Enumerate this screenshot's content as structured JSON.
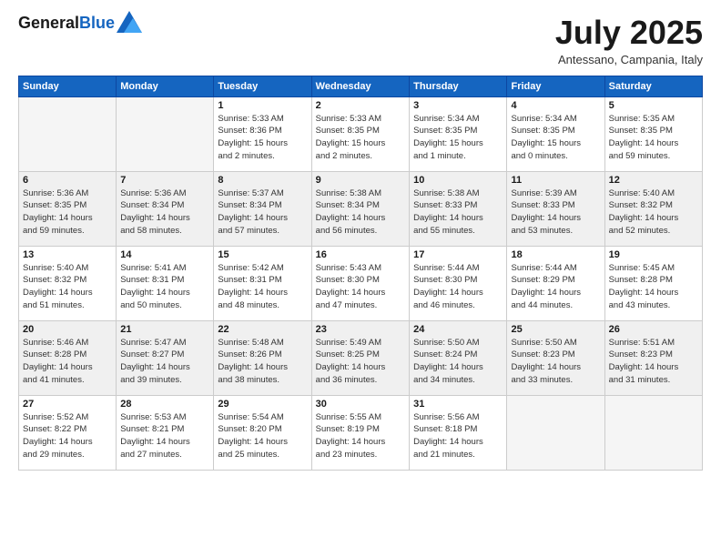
{
  "header": {
    "logo_general": "General",
    "logo_blue": "Blue",
    "month": "July 2025",
    "location": "Antessano, Campania, Italy"
  },
  "days_of_week": [
    "Sunday",
    "Monday",
    "Tuesday",
    "Wednesday",
    "Thursday",
    "Friday",
    "Saturday"
  ],
  "weeks": [
    [
      {
        "day": "",
        "info": ""
      },
      {
        "day": "",
        "info": ""
      },
      {
        "day": "1",
        "info": "Sunrise: 5:33 AM\nSunset: 8:36 PM\nDaylight: 15 hours\nand 2 minutes."
      },
      {
        "day": "2",
        "info": "Sunrise: 5:33 AM\nSunset: 8:35 PM\nDaylight: 15 hours\nand 2 minutes."
      },
      {
        "day": "3",
        "info": "Sunrise: 5:34 AM\nSunset: 8:35 PM\nDaylight: 15 hours\nand 1 minute."
      },
      {
        "day": "4",
        "info": "Sunrise: 5:34 AM\nSunset: 8:35 PM\nDaylight: 15 hours\nand 0 minutes."
      },
      {
        "day": "5",
        "info": "Sunrise: 5:35 AM\nSunset: 8:35 PM\nDaylight: 14 hours\nand 59 minutes."
      }
    ],
    [
      {
        "day": "6",
        "info": "Sunrise: 5:36 AM\nSunset: 8:35 PM\nDaylight: 14 hours\nand 59 minutes."
      },
      {
        "day": "7",
        "info": "Sunrise: 5:36 AM\nSunset: 8:34 PM\nDaylight: 14 hours\nand 58 minutes."
      },
      {
        "day": "8",
        "info": "Sunrise: 5:37 AM\nSunset: 8:34 PM\nDaylight: 14 hours\nand 57 minutes."
      },
      {
        "day": "9",
        "info": "Sunrise: 5:38 AM\nSunset: 8:34 PM\nDaylight: 14 hours\nand 56 minutes."
      },
      {
        "day": "10",
        "info": "Sunrise: 5:38 AM\nSunset: 8:33 PM\nDaylight: 14 hours\nand 55 minutes."
      },
      {
        "day": "11",
        "info": "Sunrise: 5:39 AM\nSunset: 8:33 PM\nDaylight: 14 hours\nand 53 minutes."
      },
      {
        "day": "12",
        "info": "Sunrise: 5:40 AM\nSunset: 8:32 PM\nDaylight: 14 hours\nand 52 minutes."
      }
    ],
    [
      {
        "day": "13",
        "info": "Sunrise: 5:40 AM\nSunset: 8:32 PM\nDaylight: 14 hours\nand 51 minutes."
      },
      {
        "day": "14",
        "info": "Sunrise: 5:41 AM\nSunset: 8:31 PM\nDaylight: 14 hours\nand 50 minutes."
      },
      {
        "day": "15",
        "info": "Sunrise: 5:42 AM\nSunset: 8:31 PM\nDaylight: 14 hours\nand 48 minutes."
      },
      {
        "day": "16",
        "info": "Sunrise: 5:43 AM\nSunset: 8:30 PM\nDaylight: 14 hours\nand 47 minutes."
      },
      {
        "day": "17",
        "info": "Sunrise: 5:44 AM\nSunset: 8:30 PM\nDaylight: 14 hours\nand 46 minutes."
      },
      {
        "day": "18",
        "info": "Sunrise: 5:44 AM\nSunset: 8:29 PM\nDaylight: 14 hours\nand 44 minutes."
      },
      {
        "day": "19",
        "info": "Sunrise: 5:45 AM\nSunset: 8:28 PM\nDaylight: 14 hours\nand 43 minutes."
      }
    ],
    [
      {
        "day": "20",
        "info": "Sunrise: 5:46 AM\nSunset: 8:28 PM\nDaylight: 14 hours\nand 41 minutes."
      },
      {
        "day": "21",
        "info": "Sunrise: 5:47 AM\nSunset: 8:27 PM\nDaylight: 14 hours\nand 39 minutes."
      },
      {
        "day": "22",
        "info": "Sunrise: 5:48 AM\nSunset: 8:26 PM\nDaylight: 14 hours\nand 38 minutes."
      },
      {
        "day": "23",
        "info": "Sunrise: 5:49 AM\nSunset: 8:25 PM\nDaylight: 14 hours\nand 36 minutes."
      },
      {
        "day": "24",
        "info": "Sunrise: 5:50 AM\nSunset: 8:24 PM\nDaylight: 14 hours\nand 34 minutes."
      },
      {
        "day": "25",
        "info": "Sunrise: 5:50 AM\nSunset: 8:23 PM\nDaylight: 14 hours\nand 33 minutes."
      },
      {
        "day": "26",
        "info": "Sunrise: 5:51 AM\nSunset: 8:23 PM\nDaylight: 14 hours\nand 31 minutes."
      }
    ],
    [
      {
        "day": "27",
        "info": "Sunrise: 5:52 AM\nSunset: 8:22 PM\nDaylight: 14 hours\nand 29 minutes."
      },
      {
        "day": "28",
        "info": "Sunrise: 5:53 AM\nSunset: 8:21 PM\nDaylight: 14 hours\nand 27 minutes."
      },
      {
        "day": "29",
        "info": "Sunrise: 5:54 AM\nSunset: 8:20 PM\nDaylight: 14 hours\nand 25 minutes."
      },
      {
        "day": "30",
        "info": "Sunrise: 5:55 AM\nSunset: 8:19 PM\nDaylight: 14 hours\nand 23 minutes."
      },
      {
        "day": "31",
        "info": "Sunrise: 5:56 AM\nSunset: 8:18 PM\nDaylight: 14 hours\nand 21 minutes."
      },
      {
        "day": "",
        "info": ""
      },
      {
        "day": "",
        "info": ""
      }
    ]
  ]
}
